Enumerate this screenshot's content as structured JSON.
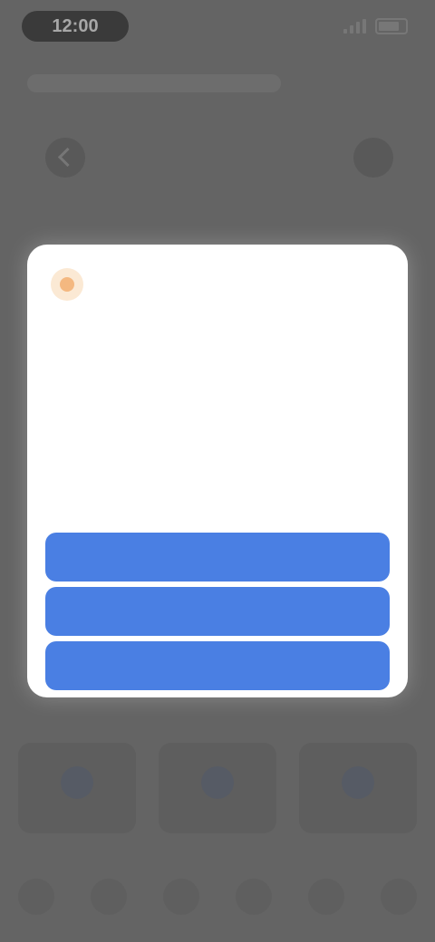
{
  "status_bar": {
    "time": "12:00"
  },
  "dialog": {
    "title": "",
    "subtitle": "",
    "message": "",
    "caption": "",
    "buttons": [
      {
        "label": ""
      },
      {
        "label": ""
      },
      {
        "label": ""
      }
    ]
  },
  "colors": {
    "dialog_button": "#4a7fe3",
    "background": "#6f6f6f",
    "dialog_background": "#ffffff"
  }
}
